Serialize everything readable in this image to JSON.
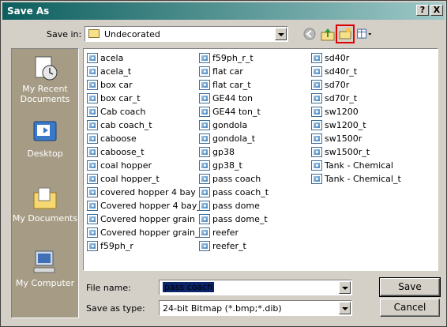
{
  "window": {
    "title": "Save As"
  },
  "titlebar": {
    "help": "?",
    "close": "X"
  },
  "savein": {
    "label": "Save in:",
    "value": "Undecorated"
  },
  "places": [
    {
      "label": "My Recent Documents",
      "icon": "recent-documents-icon"
    },
    {
      "label": "Desktop",
      "icon": "desktop-icon"
    },
    {
      "label": "My Documents",
      "icon": "my-documents-icon"
    },
    {
      "label": "My Computer",
      "icon": "my-computer-icon"
    }
  ],
  "files": {
    "col1": [
      "acela",
      "acela_t",
      "box car",
      "box car_t",
      "Cab coach",
      "cab coach_t",
      "caboose",
      "caboose_t",
      "coal hopper",
      "coal hopper_t",
      "covered hopper 4 bay",
      "Covered hopper 4 bay_t",
      "Covered hopper grain",
      "Covered hopper grain_t",
      "f59ph_r"
    ],
    "col2": [
      "f59ph_r_t",
      "flat car",
      "flat car_t",
      "GE44 ton",
      "GE44 ton_t",
      "gondola",
      "gondola_t",
      "gp38",
      "gp38_t",
      "pass coach",
      "pass coach_t",
      "pass dome",
      "pass dome_t",
      "reefer",
      "reefer_t"
    ],
    "col3": [
      "sd40r",
      "sd40r_t",
      "sd70r",
      "sd70r_t",
      "sw1200",
      "sw1200_t",
      "sw1500r",
      "sw1500r_t",
      "Tank - Chemical",
      "Tank - Chemical_t"
    ]
  },
  "filename": {
    "label": "File name:",
    "value": "pass coach"
  },
  "savetype": {
    "label": "Save as type:",
    "value": "24-bit Bitmap (*.bmp;*.dib)"
  },
  "buttons": {
    "save": "Save",
    "cancel": "Cancel"
  },
  "colors": {
    "highlight_box": "#e00000",
    "places_bg": "#a69c85",
    "selection": "#0a246a"
  }
}
